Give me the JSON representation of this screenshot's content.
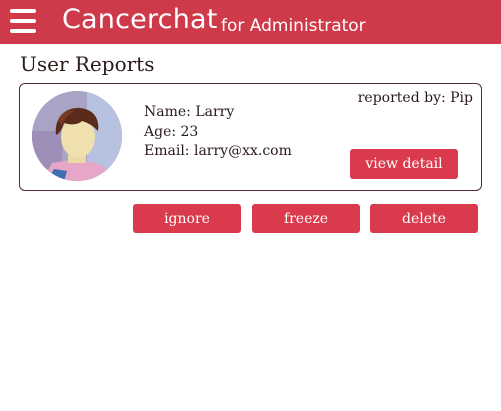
{
  "header": {
    "title": "Cancerchat",
    "subtitle": "for Administrator",
    "menu_icon": "hamburger-menu-icon",
    "background_color": "#cf3a4a"
  },
  "page": {
    "title": "User Reports"
  },
  "report": {
    "reported_by": "reported by: Pip",
    "name": "Name: Larry",
    "age": "Age: 23",
    "email": "Email: larry@xx.com",
    "view_detail_label": "view detail"
  },
  "actions": {
    "ignore_label": "ignore",
    "freeze_label": "freeze",
    "delete_label": "delete"
  },
  "colors": {
    "accent": "#d93a4c",
    "card_border": "#5a2a32",
    "text": "#2a1a1a"
  }
}
